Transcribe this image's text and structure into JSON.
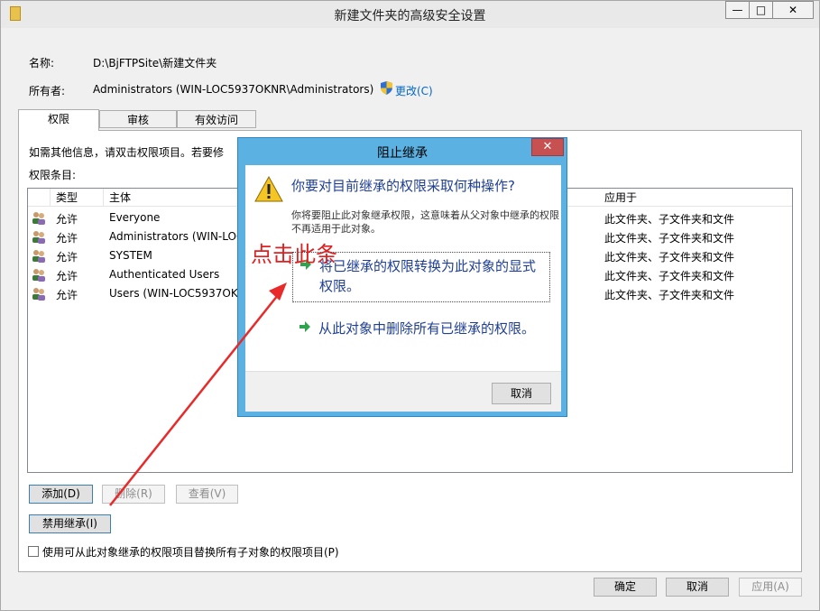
{
  "window": {
    "title": "新建文件夹的高级安全设置",
    "minimize_glyph": "—",
    "maximize_glyph": "□",
    "close_glyph": "✕",
    "icon": "folder-icon"
  },
  "info": {
    "name_label": "名称:",
    "name_value": "D:\\BjFTPSite\\新建文件夹",
    "owner_label": "所有者:",
    "owner_value": "Administrators (WIN-LOC5937OKNR\\Administrators)",
    "change_link": "更改(C)",
    "change_icon": "shield-icon"
  },
  "tabs": [
    {
      "label": "权限",
      "active": true
    },
    {
      "label": "审核",
      "active": false
    },
    {
      "label": "有效访问",
      "active": false
    }
  ],
  "permissions": {
    "info_text": "如需其他信息，请双击权限项目。若要修",
    "entries_label": "权限条目:",
    "columns": {
      "type": "类型",
      "principal": "主体",
      "apply_to": "应用于"
    },
    "rows": [
      {
        "type": "允许",
        "principal": "Everyone",
        "apply_to": "此文件夹、子文件夹和文件"
      },
      {
        "type": "允许",
        "principal": "Administrators (WIN-LOC",
        "apply_to": "此文件夹、子文件夹和文件"
      },
      {
        "type": "允许",
        "principal": "SYSTEM",
        "apply_to": "此文件夹、子文件夹和文件"
      },
      {
        "type": "允许",
        "principal": "Authenticated Users",
        "apply_to": "此文件夹、子文件夹和文件"
      },
      {
        "type": "允许",
        "principal": "Users (WIN-LOC5937OK",
        "apply_to": "此文件夹、子文件夹和文件"
      }
    ],
    "row_icon": "users-icon"
  },
  "buttons": {
    "add": "添加(D)",
    "remove": "删除(R)",
    "view": "查看(V)",
    "disable_inheritance": "禁用继承(I)",
    "replace_checkbox": "使用可从此对象继承的权限项目替换所有子对象的权限项目(P)",
    "ok": "确定",
    "cancel": "取消",
    "apply": "应用(A)"
  },
  "dialog": {
    "title": "阻止继承",
    "close_glyph": "✕",
    "question": "你要对目前继承的权限采取何种操作?",
    "description": "你将要阻止此对象继承权限，这意味着从父对象中继承的权限不再适用于此对象。",
    "option1": "将已继承的权限转换为此对象的显式权限。",
    "option2": "从此对象中删除所有已继承的权限。",
    "cancel": "取消",
    "warning_icon": "warning-icon",
    "arrow_icon": "green-arrow-icon"
  },
  "annotation": {
    "text": "点击此条",
    "color": "#e02020"
  }
}
